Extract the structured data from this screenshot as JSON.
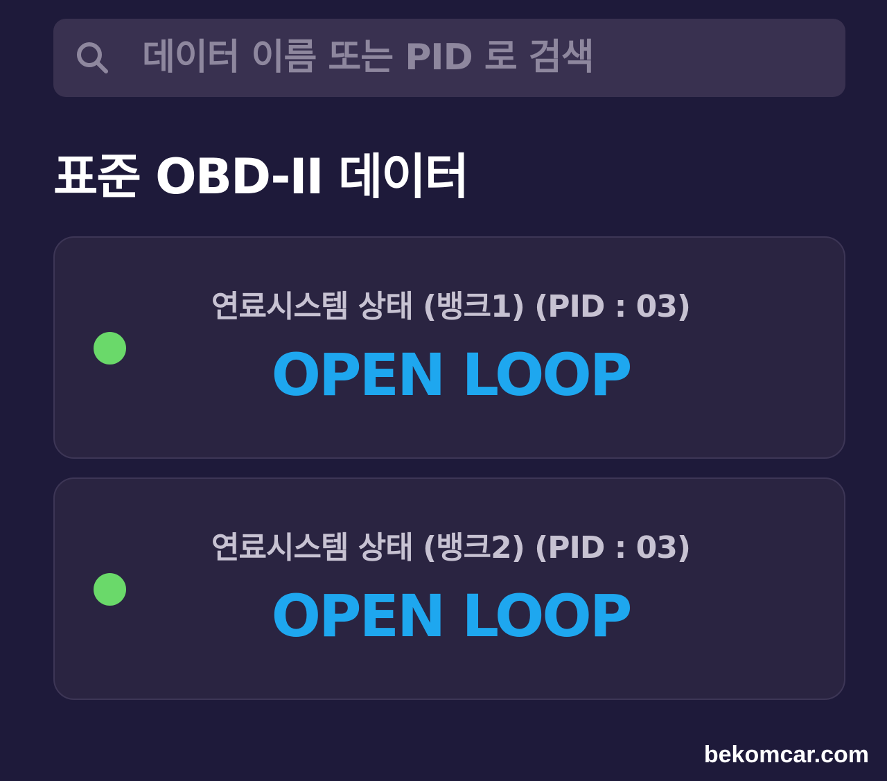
{
  "search": {
    "icon": "search-icon",
    "placeholder": "데이터 이름 또는 PID 로 검색"
  },
  "section": {
    "title": "표준 OBD-II 데이터"
  },
  "items": [
    {
      "label": "연료시스템 상태 (뱅크1) (PID : 03)",
      "value": "OPEN LOOP",
      "status_color": "#6ad96a"
    },
    {
      "label": "연료시스템 상태 (뱅크2) (PID : 03)",
      "value": "OPEN LOOP",
      "status_color": "#6ad96a"
    }
  ],
  "watermark": "bekomcar.com",
  "colors": {
    "background": "#1e1a3a",
    "card": "#2a2441",
    "accent_value": "#1ea7ef",
    "status_ok": "#6ad96a"
  }
}
